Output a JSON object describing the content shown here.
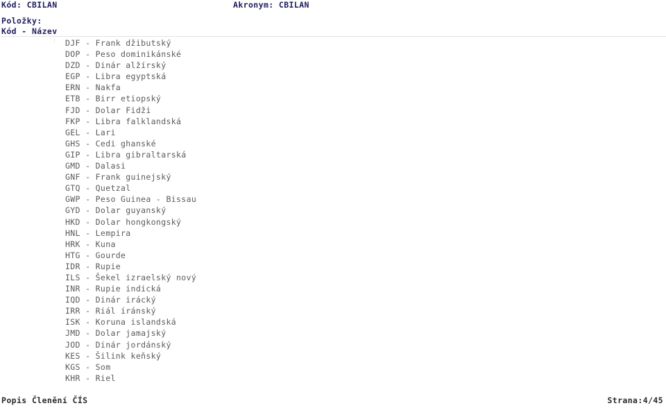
{
  "header": {
    "code_label": "Kód:",
    "code_value": "CBILAN",
    "code_line": "Kód: CBILAN",
    "acronym_label": "Akronym:",
    "acronym_value": "CBILAN",
    "acronym_line": "Akronym: CBILAN",
    "items_label": "Položky:",
    "columns_line": "Kód - Název"
  },
  "list": {
    "items": [
      {
        "code": "DJF",
        "name": "Frank džibutský",
        "line": "DJF - Frank džibutský"
      },
      {
        "code": "DOP",
        "name": "Peso dominikánské",
        "line": "DOP - Peso dominikánské"
      },
      {
        "code": "DZD",
        "name": "Dinár alžírský",
        "line": "DZD - Dinár alžírský"
      },
      {
        "code": "EGP",
        "name": "Libra egyptská",
        "line": "EGP - Libra egyptská"
      },
      {
        "code": "ERN",
        "name": "Nakfa",
        "line": "ERN - Nakfa"
      },
      {
        "code": "ETB",
        "name": "Birr etiopský",
        "line": "ETB - Birr etiopský"
      },
      {
        "code": "FJD",
        "name": "Dolar Fidži",
        "line": "FJD - Dolar Fidži"
      },
      {
        "code": "FKP",
        "name": "Libra falklandská",
        "line": "FKP - Libra falklandská"
      },
      {
        "code": "GEL",
        "name": "Lari",
        "line": "GEL - Lari"
      },
      {
        "code": "GHS",
        "name": "Cedi ghanské",
        "line": "GHS - Cedi ghanské"
      },
      {
        "code": "GIP",
        "name": "Libra gibraltarská",
        "line": "GIP - Libra gibraltarská"
      },
      {
        "code": "GMD",
        "name": "Dalasi",
        "line": "GMD - Dalasi"
      },
      {
        "code": "GNF",
        "name": "Frank guinejský",
        "line": "GNF - Frank guinejský"
      },
      {
        "code": "GTQ",
        "name": "Quetzal",
        "line": "GTQ - Quetzal"
      },
      {
        "code": "GWP",
        "name": "Peso Guinea - Bissau",
        "line": "GWP - Peso Guinea - Bissau"
      },
      {
        "code": "GYD",
        "name": "Dolar guyanský",
        "line": "GYD - Dolar guyanský"
      },
      {
        "code": "HKD",
        "name": "Dolar hongkongský",
        "line": "HKD - Dolar hongkongský"
      },
      {
        "code": "HNL",
        "name": "Lempira",
        "line": "HNL - Lempira"
      },
      {
        "code": "HRK",
        "name": "Kuna",
        "line": "HRK - Kuna"
      },
      {
        "code": "HTG",
        "name": "Gourde",
        "line": "HTG - Gourde"
      },
      {
        "code": "IDR",
        "name": "Rupie",
        "line": "IDR - Rupie"
      },
      {
        "code": "ILS",
        "name": "Šekel izraelský nový",
        "line": "ILS - Šekel izraelský nový"
      },
      {
        "code": "INR",
        "name": "Rupie indická",
        "line": "INR - Rupie indická"
      },
      {
        "code": "IQD",
        "name": "Dinár irácký",
        "line": "IQD - Dinár irácký"
      },
      {
        "code": "IRR",
        "name": "Riál íránský",
        "line": "IRR - Riál íránský"
      },
      {
        "code": "ISK",
        "name": "Koruna islandská",
        "line": "ISK - Koruna islandská"
      },
      {
        "code": "JMD",
        "name": "Dolar jamajský",
        "line": "JMD - Dolar jamajský"
      },
      {
        "code": "JOD",
        "name": "Dinár jordánský",
        "line": "JOD - Dinár jordánský"
      },
      {
        "code": "KES",
        "name": "Šilink keňský",
        "line": "KES - Šilink keňský"
      },
      {
        "code": "KGS",
        "name": "Som",
        "line": "KGS - Som"
      },
      {
        "code": "KHR",
        "name": "Riel",
        "line": "KHR - Riel"
      }
    ]
  },
  "footer": {
    "left": "Popis Členění ČÍS",
    "right": "Strana:4/45",
    "page_current": "4",
    "page_total": "45"
  },
  "colors": {
    "heading": "#1c1c5c",
    "body_text": "#5a5a5a",
    "footer_text": "#2a2a2a",
    "divider": "#e2e2e6",
    "background": "#ffffff"
  }
}
